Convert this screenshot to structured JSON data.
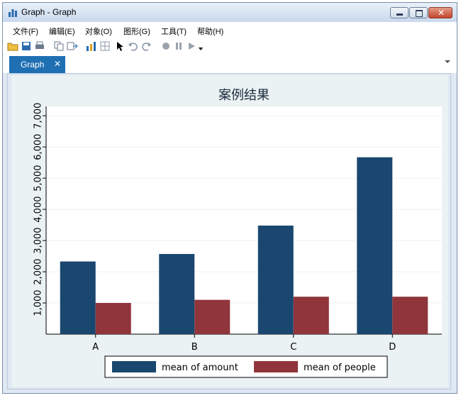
{
  "window": {
    "title": "Graph - Graph"
  },
  "menu": [
    "文件(F)",
    "编辑(E)",
    "对象(O)",
    "图形(G)",
    "工具(T)",
    "帮助(H)"
  ],
  "toolbar_icons": [
    "open-icon",
    "save-icon",
    "print-icon",
    "copy-icon",
    "export-icon",
    "graph-editor-icon",
    "panel-icon",
    "pointer-icon",
    "undo-icon",
    "redo-icon",
    "record-icon",
    "pause-icon",
    "play-icon"
  ],
  "tabs": [
    {
      "label": "Graph",
      "close": "✕"
    }
  ],
  "colors": {
    "amount": "#1a476f",
    "people": "#90353b",
    "plot_bg": "#ffffff",
    "graph_bg": "#eaf2f3",
    "tab": "#1f6fb3"
  },
  "chart_data": {
    "type": "bar",
    "title": "案例结果",
    "categories": [
      "A",
      "B",
      "C",
      "D"
    ],
    "series": [
      {
        "name": "mean of amount",
        "values": [
          2330,
          2570,
          3480,
          5670
        ]
      },
      {
        "name": "mean of people",
        "values": [
          1000,
          1100,
          1200,
          1200
        ]
      }
    ],
    "yticks": [
      "1,000",
      "2,000",
      "3,000",
      "4,000",
      "5,000",
      "6,000",
      "7,000"
    ],
    "ylim": [
      0,
      7300
    ],
    "grid": true,
    "legend": "bottom"
  }
}
